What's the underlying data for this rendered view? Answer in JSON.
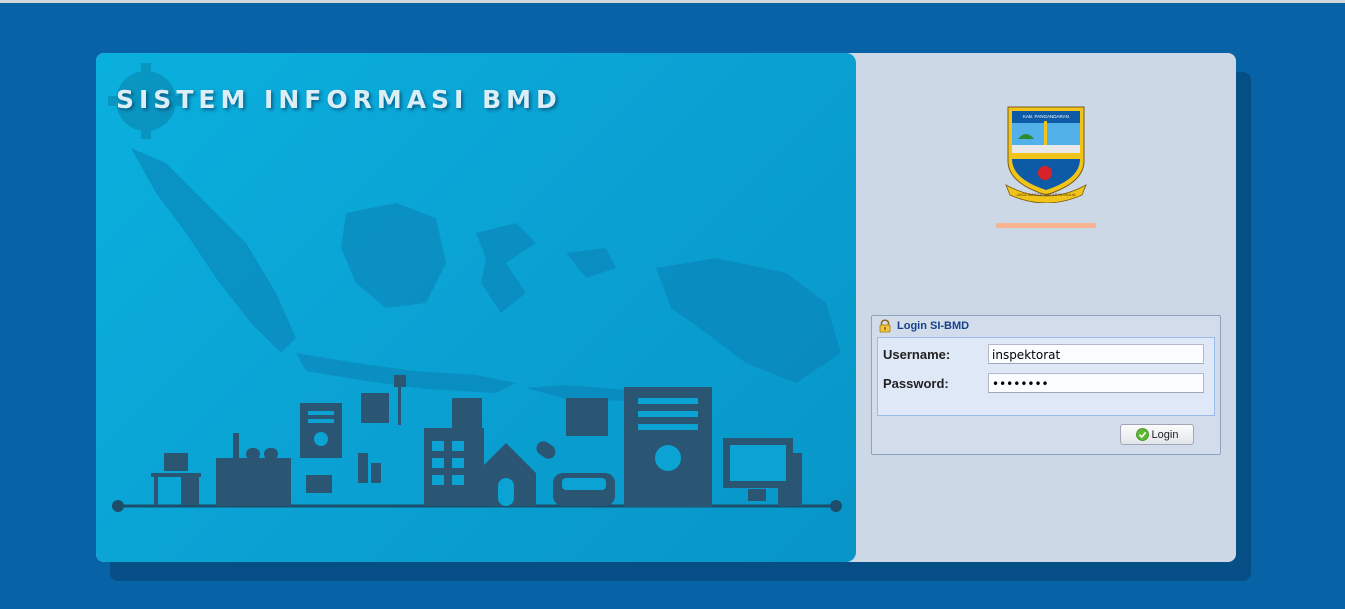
{
  "banner": {
    "title": "SISTEM INFORMASI BMD"
  },
  "emblem": {
    "top_text": "KAB. PANGANDARAN",
    "ribbon_text": "JAGA MARGA MAKARYA MULIA"
  },
  "login": {
    "header": "Login SI-BMD",
    "username_label": "Username:",
    "username_value": "inspektorat",
    "password_label": "Password:",
    "password_value": "••••••••",
    "button_label": "Login"
  },
  "colors": {
    "page_bg": "#0763a6",
    "banner_bg": "#0aa3d4",
    "accent_bar": "#f7b48f",
    "header_text": "#15428b"
  }
}
